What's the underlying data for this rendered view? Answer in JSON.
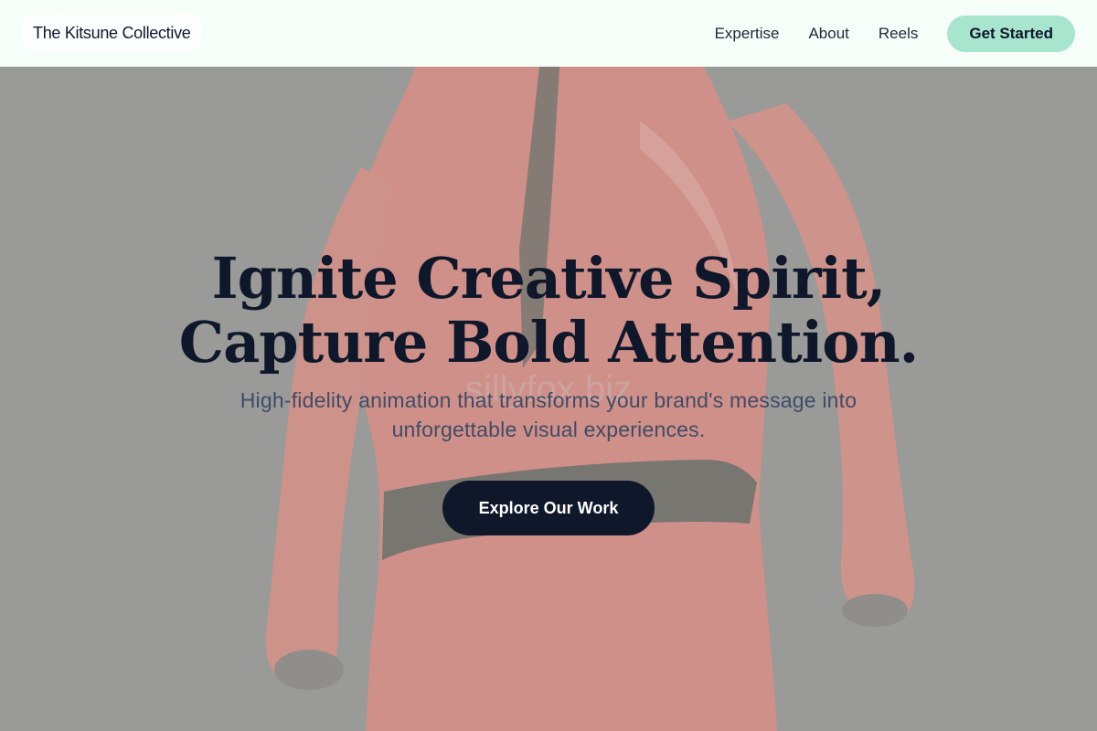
{
  "header": {
    "brand": "The Kitsune Collective",
    "nav": [
      {
        "label": "Expertise"
      },
      {
        "label": "About"
      },
      {
        "label": "Reels"
      }
    ],
    "cta_label": "Get Started"
  },
  "hero": {
    "title_line1": "Ignite Creative Spirit,",
    "title_line2": "Capture Bold Attention.",
    "subtitle": "High-fidelity animation that transforms your brand's message into unforgettable visual experiences.",
    "button_label": "Explore Our Work",
    "watermark": "sillyfox.biz"
  },
  "colors": {
    "header_bg": "#f6fef9",
    "cta_bg": "#a7e5cf",
    "primary_dark": "#0f172a",
    "hero_bg": "#999996",
    "figure": "#e07a6e"
  }
}
